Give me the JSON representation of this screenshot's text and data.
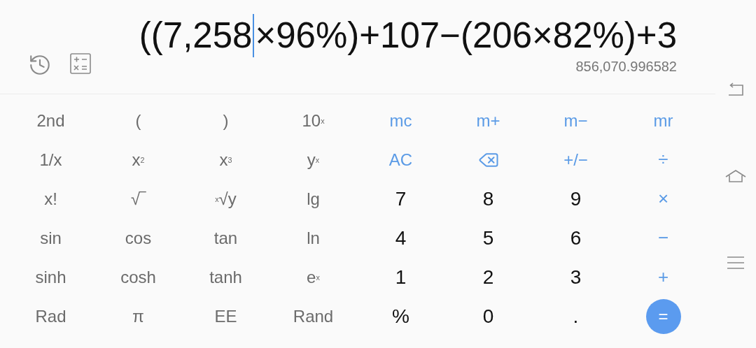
{
  "display": {
    "expression": {
      "before_cursor": "((7,258",
      "after_cursor": "×96%)+107−(206×82%)+3"
    },
    "result": "856,070.996582"
  },
  "keys": [
    {
      "label": "2nd",
      "kind": "fn"
    },
    {
      "label": "(",
      "kind": "fn"
    },
    {
      "label": ")",
      "kind": "fn"
    },
    {
      "label": "10$^{x}$",
      "kind": "fn"
    },
    {
      "label": "mc",
      "kind": "memory"
    },
    {
      "label": "m+",
      "kind": "memory"
    },
    {
      "label": "m−",
      "kind": "memory"
    },
    {
      "label": "mr",
      "kind": "memory"
    },
    {
      "label": "1/x",
      "kind": "fn"
    },
    {
      "label": "x$^{2}$",
      "kind": "fn"
    },
    {
      "label": "x$^{3}$",
      "kind": "fn"
    },
    {
      "label": "y$^{x}$",
      "kind": "fn"
    },
    {
      "label": "AC",
      "kind": "memory"
    },
    {
      "kind": "backspace"
    },
    {
      "label": "+/−",
      "kind": "memory"
    },
    {
      "label": "÷",
      "kind": "operator"
    },
    {
      "label": "x!",
      "kind": "fn"
    },
    {
      "label": "√‾",
      "kind": "fn"
    },
    {
      "label": "$^{x}$√y",
      "kind": "fn"
    },
    {
      "label": "lg",
      "kind": "fn"
    },
    {
      "label": "7",
      "kind": "digit"
    },
    {
      "label": "8",
      "kind": "digit"
    },
    {
      "label": "9",
      "kind": "digit"
    },
    {
      "label": "×",
      "kind": "operator"
    },
    {
      "label": "sin",
      "kind": "fn"
    },
    {
      "label": "cos",
      "kind": "fn"
    },
    {
      "label": "tan",
      "kind": "fn"
    },
    {
      "label": "ln",
      "kind": "fn"
    },
    {
      "label": "4",
      "kind": "digit"
    },
    {
      "label": "5",
      "kind": "digit"
    },
    {
      "label": "6",
      "kind": "digit"
    },
    {
      "label": "−",
      "kind": "operator"
    },
    {
      "label": "sinh",
      "kind": "fn"
    },
    {
      "label": "cosh",
      "kind": "fn"
    },
    {
      "label": "tanh",
      "kind": "fn"
    },
    {
      "label": "e$^{x}$",
      "kind": "fn"
    },
    {
      "label": "1",
      "kind": "digit"
    },
    {
      "label": "2",
      "kind": "digit"
    },
    {
      "label": "3",
      "kind": "digit"
    },
    {
      "label": "+",
      "kind": "operator"
    },
    {
      "label": "Rad",
      "kind": "fn"
    },
    {
      "label": "π",
      "kind": "fn"
    },
    {
      "label": "EE",
      "kind": "fn"
    },
    {
      "label": "Rand",
      "kind": "fn"
    },
    {
      "label": "%",
      "kind": "digit"
    },
    {
      "label": "0",
      "kind": "digit"
    },
    {
      "label": ".",
      "kind": "digit"
    },
    {
      "label": "=",
      "kind": "equals"
    }
  ]
}
